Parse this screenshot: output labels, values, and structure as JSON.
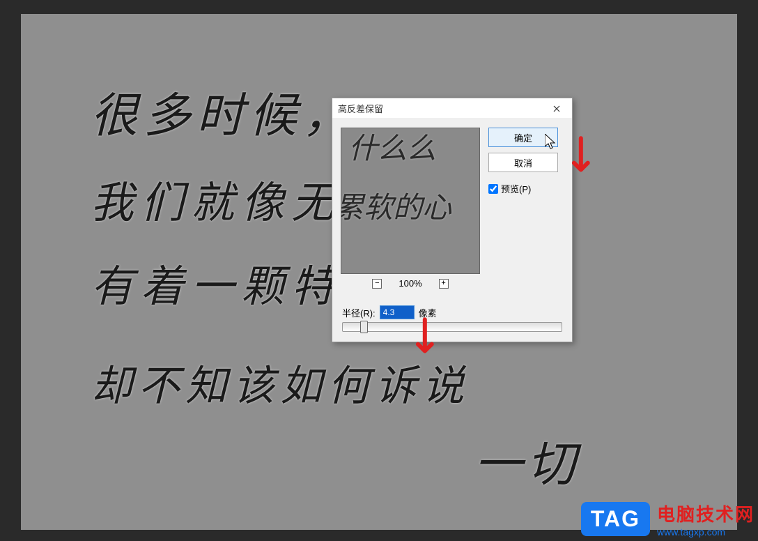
{
  "canvas": {
    "handwriting_line1": "很多时候，",
    "handwriting_line2": "我们就像无脑",
    "handwriting_line3": "有着一颗特别累",
    "handwriting_line4": "却不知该如何诉说",
    "signature": "一切"
  },
  "dialog": {
    "title": "高反差保留",
    "ok_label": "确定",
    "cancel_label": "取消",
    "preview_label": "预览(P)",
    "preview_checked": true,
    "zoom_out": "−",
    "zoom_level": "100%",
    "zoom_in": "+",
    "radius_label": "半径(R):",
    "radius_value": "4.3",
    "radius_unit": "像素",
    "preview_hw1": "什么么",
    "preview_hw2": "累软的心"
  },
  "watermark": {
    "badge": "TAG",
    "main_text": "电脑技术网",
    "sub_text": "www.tagxp.com"
  }
}
